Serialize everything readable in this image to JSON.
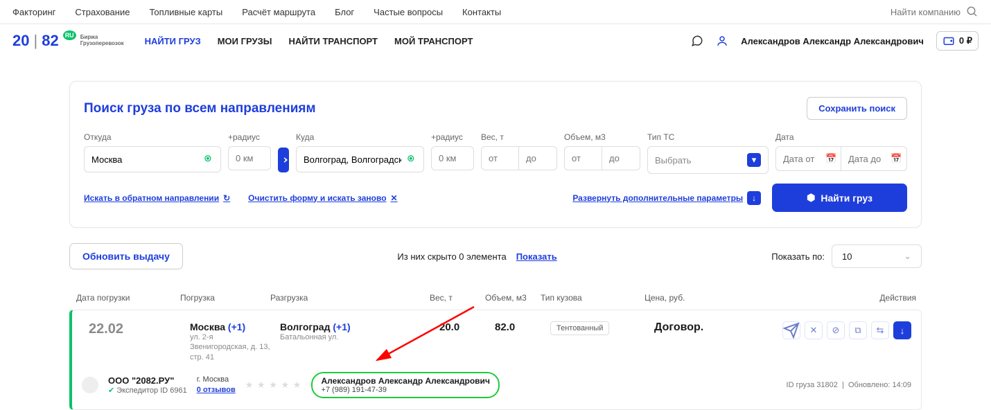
{
  "topnav": [
    "Факторинг",
    "Страхование",
    "Топливные карты",
    "Расчёт маршрута",
    "Блог",
    "Частые вопросы",
    "Контакты"
  ],
  "search_placeholder": "Найти компанию",
  "logo": {
    "a": "20",
    "b": "|",
    "c": "82",
    "tag": "RU",
    "sub1": "Биржа",
    "sub2": "Грузоперевозок"
  },
  "mainnav": [
    {
      "t": "НАЙТИ ГРУЗ",
      "active": true
    },
    {
      "t": "МОИ ГРУЗЫ"
    },
    {
      "t": "НАЙТИ ТРАНСПОРТ"
    },
    {
      "t": "МОЙ ТРАНСПОРТ"
    }
  ],
  "user": "Александров Александр Александрович",
  "balance": "0 ₽",
  "panel_title": "Поиск груза по всем направлениям",
  "save_btn": "Сохранить поиск",
  "f": {
    "from_l": "Откуда",
    "from_v": "Москва",
    "rad_l": "+радиус",
    "rad_ph": "0 км",
    "to_l": "Куда",
    "to_v": "Волгоград, Волгоградска..",
    "wt_l": "Вес, т",
    "wt_ph1": "от",
    "wt_ph2": "до",
    "vol_l": "Объем, м3",
    "type_l": "Тип ТС",
    "type_ph": "Выбрать",
    "date_l": "Дата",
    "date_ph1": "Дата от",
    "date_ph2": "Дата до"
  },
  "link_reverse": "Искать в обратном направлении",
  "link_clear": "Очистить форму и искать заново",
  "link_expand": "Развернуть дополнительные параметры",
  "submit": "Найти груз",
  "refresh": "Обновить выдачу",
  "hidden_text": "Из них скрыто 0 элемента",
  "show": "Показать",
  "per_label": "Показать по:",
  "per_value": "10",
  "headers": {
    "date": "Дата погрузки",
    "load": "Погрузка",
    "unload": "Разгрузка",
    "wt": "Вес, т",
    "vol": "Объем, м3",
    "body": "Тип кузова",
    "price": "Цена, руб.",
    "act": "Действия"
  },
  "card": {
    "date": "22.02",
    "load_city": "Москва",
    "load_plus": "(+1)",
    "load_addr": "ул. 2-я Звенигородская, д. 13, стр. 41",
    "unload_city": "Волгоград",
    "unload_plus": "(+1)",
    "unload_addr": "Батальонная ул.",
    "weight": "20.0",
    "volume": "82.0",
    "body": "Тентованный",
    "price": "Договор.",
    "company": "ООО \"2082.РУ\"",
    "comp_sub": "Экспедитор ID 6961",
    "comp_city": "г. Москва",
    "reviews": "0 отзывов",
    "contact_name": "Александров Александр Александрович",
    "contact_phone": "+7 (989) 191-47-39",
    "id": "ID груза 31802",
    "updated": "Обновлено: 14:09"
  }
}
